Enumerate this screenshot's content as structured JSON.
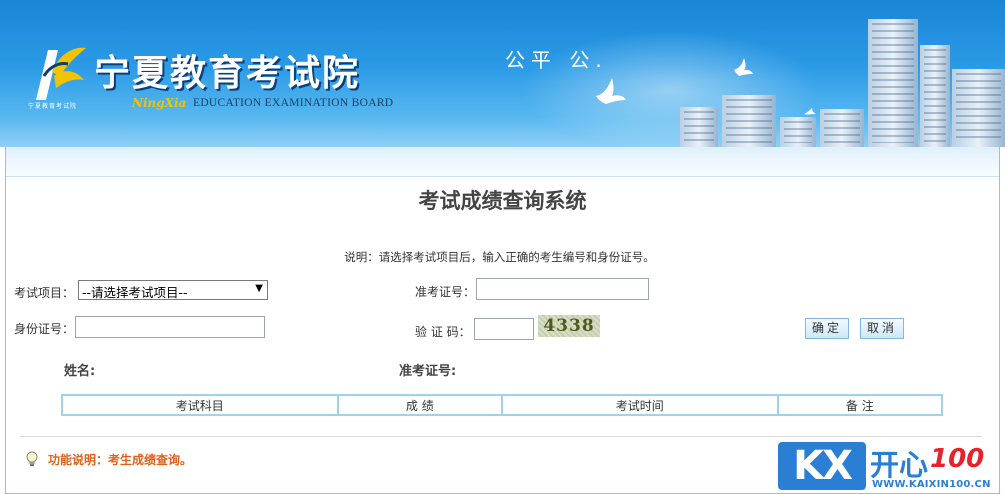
{
  "header": {
    "site_title": "宁夏教育考试院",
    "logo_small_text": "宁夏教育考试院",
    "brand_script": "NingXia",
    "brand_english": "EDUCATION EXAMINATION BOARD",
    "slogan": "公平 公."
  },
  "page": {
    "title": "考试成绩查询系统",
    "instruction": "说明：请选择考试项目后，输入正确的考生编号和身份证号。"
  },
  "form": {
    "exam_item_label": "考试项目：",
    "exam_item_selected": "--请选择考试项目--",
    "admission_no_label": "准考证号：",
    "admission_no_value": "",
    "id_card_label": "身份证号：",
    "id_card_value": "",
    "captcha_label": "验 证 码：",
    "captcha_value": "",
    "captcha_image_text": "4338",
    "confirm_button": "确定",
    "cancel_button": "取消"
  },
  "result": {
    "name_label": "姓名:",
    "admission_no_label": "准考证号:",
    "columns": [
      "考试科目",
      "成 绩",
      "考试时间",
      "备 注"
    ]
  },
  "footer": {
    "function_note": "功能说明：考生成绩查询。"
  },
  "watermark": {
    "logo_letters": "KX",
    "brand_cn": "开心",
    "brand_num": "100",
    "url": "WWW.KAIXIN100.CN"
  },
  "colors": {
    "banner_blue": "#1a86d6",
    "panel_border": "#8cc4e8",
    "table_border": "#9ed3ea",
    "function_note": "#e0611a"
  },
  "icons": {
    "bulb": "lightbulb-icon",
    "select_arrow": "dropdown-arrow-icon"
  }
}
